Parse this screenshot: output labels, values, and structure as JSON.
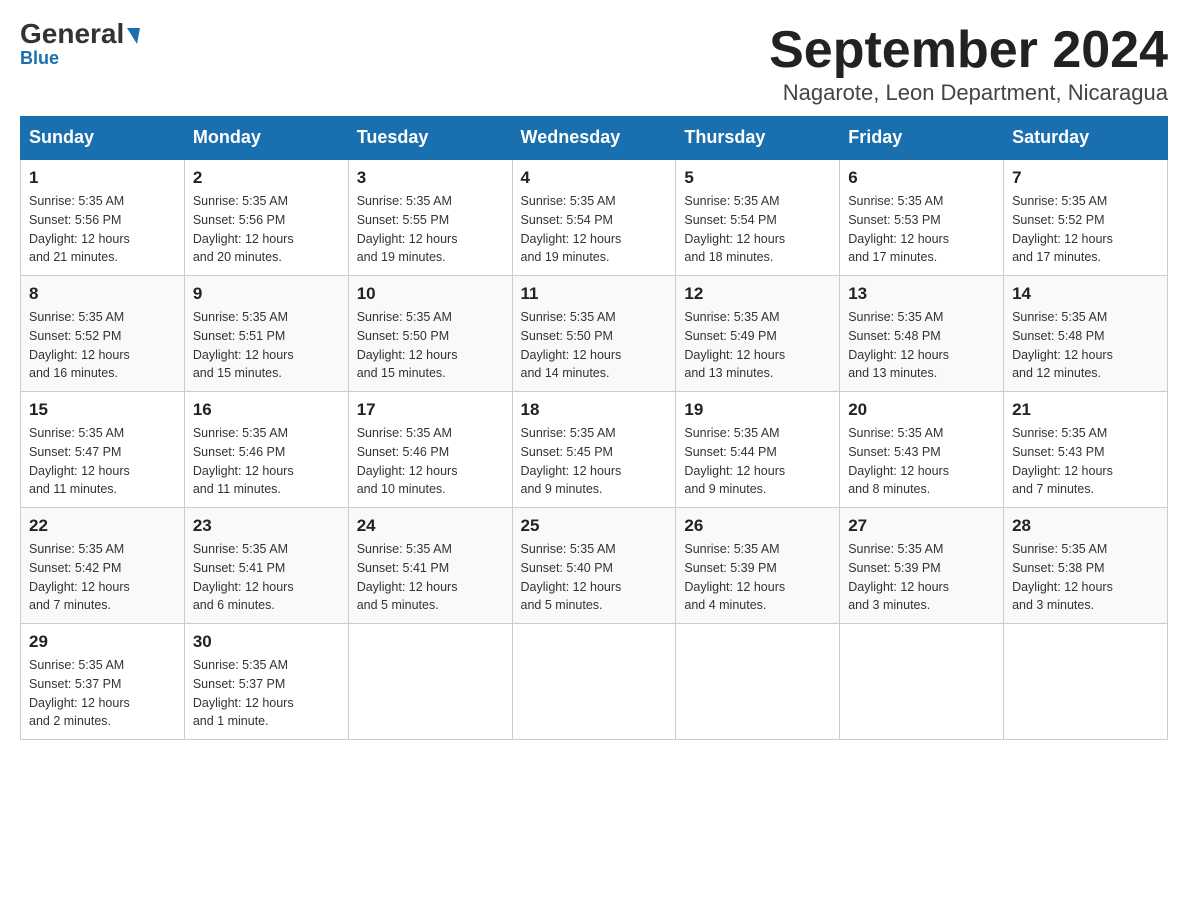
{
  "header": {
    "logo_main": "General",
    "logo_blue": "Blue",
    "title": "September 2024",
    "subtitle": "Nagarote, Leon Department, Nicaragua"
  },
  "days_of_week": [
    "Sunday",
    "Monday",
    "Tuesday",
    "Wednesday",
    "Thursday",
    "Friday",
    "Saturday"
  ],
  "weeks": [
    [
      {
        "day": "1",
        "sunrise": "5:35 AM",
        "sunset": "5:56 PM",
        "daylight": "12 hours and 21 minutes."
      },
      {
        "day": "2",
        "sunrise": "5:35 AM",
        "sunset": "5:56 PM",
        "daylight": "12 hours and 20 minutes."
      },
      {
        "day": "3",
        "sunrise": "5:35 AM",
        "sunset": "5:55 PM",
        "daylight": "12 hours and 19 minutes."
      },
      {
        "day": "4",
        "sunrise": "5:35 AM",
        "sunset": "5:54 PM",
        "daylight": "12 hours and 19 minutes."
      },
      {
        "day": "5",
        "sunrise": "5:35 AM",
        "sunset": "5:54 PM",
        "daylight": "12 hours and 18 minutes."
      },
      {
        "day": "6",
        "sunrise": "5:35 AM",
        "sunset": "5:53 PM",
        "daylight": "12 hours and 17 minutes."
      },
      {
        "day": "7",
        "sunrise": "5:35 AM",
        "sunset": "5:52 PM",
        "daylight": "12 hours and 17 minutes."
      }
    ],
    [
      {
        "day": "8",
        "sunrise": "5:35 AM",
        "sunset": "5:52 PM",
        "daylight": "12 hours and 16 minutes."
      },
      {
        "day": "9",
        "sunrise": "5:35 AM",
        "sunset": "5:51 PM",
        "daylight": "12 hours and 15 minutes."
      },
      {
        "day": "10",
        "sunrise": "5:35 AM",
        "sunset": "5:50 PM",
        "daylight": "12 hours and 15 minutes."
      },
      {
        "day": "11",
        "sunrise": "5:35 AM",
        "sunset": "5:50 PM",
        "daylight": "12 hours and 14 minutes."
      },
      {
        "day": "12",
        "sunrise": "5:35 AM",
        "sunset": "5:49 PM",
        "daylight": "12 hours and 13 minutes."
      },
      {
        "day": "13",
        "sunrise": "5:35 AM",
        "sunset": "5:48 PM",
        "daylight": "12 hours and 13 minutes."
      },
      {
        "day": "14",
        "sunrise": "5:35 AM",
        "sunset": "5:48 PM",
        "daylight": "12 hours and 12 minutes."
      }
    ],
    [
      {
        "day": "15",
        "sunrise": "5:35 AM",
        "sunset": "5:47 PM",
        "daylight": "12 hours and 11 minutes."
      },
      {
        "day": "16",
        "sunrise": "5:35 AM",
        "sunset": "5:46 PM",
        "daylight": "12 hours and 11 minutes."
      },
      {
        "day": "17",
        "sunrise": "5:35 AM",
        "sunset": "5:46 PM",
        "daylight": "12 hours and 10 minutes."
      },
      {
        "day": "18",
        "sunrise": "5:35 AM",
        "sunset": "5:45 PM",
        "daylight": "12 hours and 9 minutes."
      },
      {
        "day": "19",
        "sunrise": "5:35 AM",
        "sunset": "5:44 PM",
        "daylight": "12 hours and 9 minutes."
      },
      {
        "day": "20",
        "sunrise": "5:35 AM",
        "sunset": "5:43 PM",
        "daylight": "12 hours and 8 minutes."
      },
      {
        "day": "21",
        "sunrise": "5:35 AM",
        "sunset": "5:43 PM",
        "daylight": "12 hours and 7 minutes."
      }
    ],
    [
      {
        "day": "22",
        "sunrise": "5:35 AM",
        "sunset": "5:42 PM",
        "daylight": "12 hours and 7 minutes."
      },
      {
        "day": "23",
        "sunrise": "5:35 AM",
        "sunset": "5:41 PM",
        "daylight": "12 hours and 6 minutes."
      },
      {
        "day": "24",
        "sunrise": "5:35 AM",
        "sunset": "5:41 PM",
        "daylight": "12 hours and 5 minutes."
      },
      {
        "day": "25",
        "sunrise": "5:35 AM",
        "sunset": "5:40 PM",
        "daylight": "12 hours and 5 minutes."
      },
      {
        "day": "26",
        "sunrise": "5:35 AM",
        "sunset": "5:39 PM",
        "daylight": "12 hours and 4 minutes."
      },
      {
        "day": "27",
        "sunrise": "5:35 AM",
        "sunset": "5:39 PM",
        "daylight": "12 hours and 3 minutes."
      },
      {
        "day": "28",
        "sunrise": "5:35 AM",
        "sunset": "5:38 PM",
        "daylight": "12 hours and 3 minutes."
      }
    ],
    [
      {
        "day": "29",
        "sunrise": "5:35 AM",
        "sunset": "5:37 PM",
        "daylight": "12 hours and 2 minutes."
      },
      {
        "day": "30",
        "sunrise": "5:35 AM",
        "sunset": "5:37 PM",
        "daylight": "12 hours and 1 minute."
      },
      null,
      null,
      null,
      null,
      null
    ]
  ],
  "labels": {
    "sunrise": "Sunrise:",
    "sunset": "Sunset:",
    "daylight": "Daylight:"
  }
}
